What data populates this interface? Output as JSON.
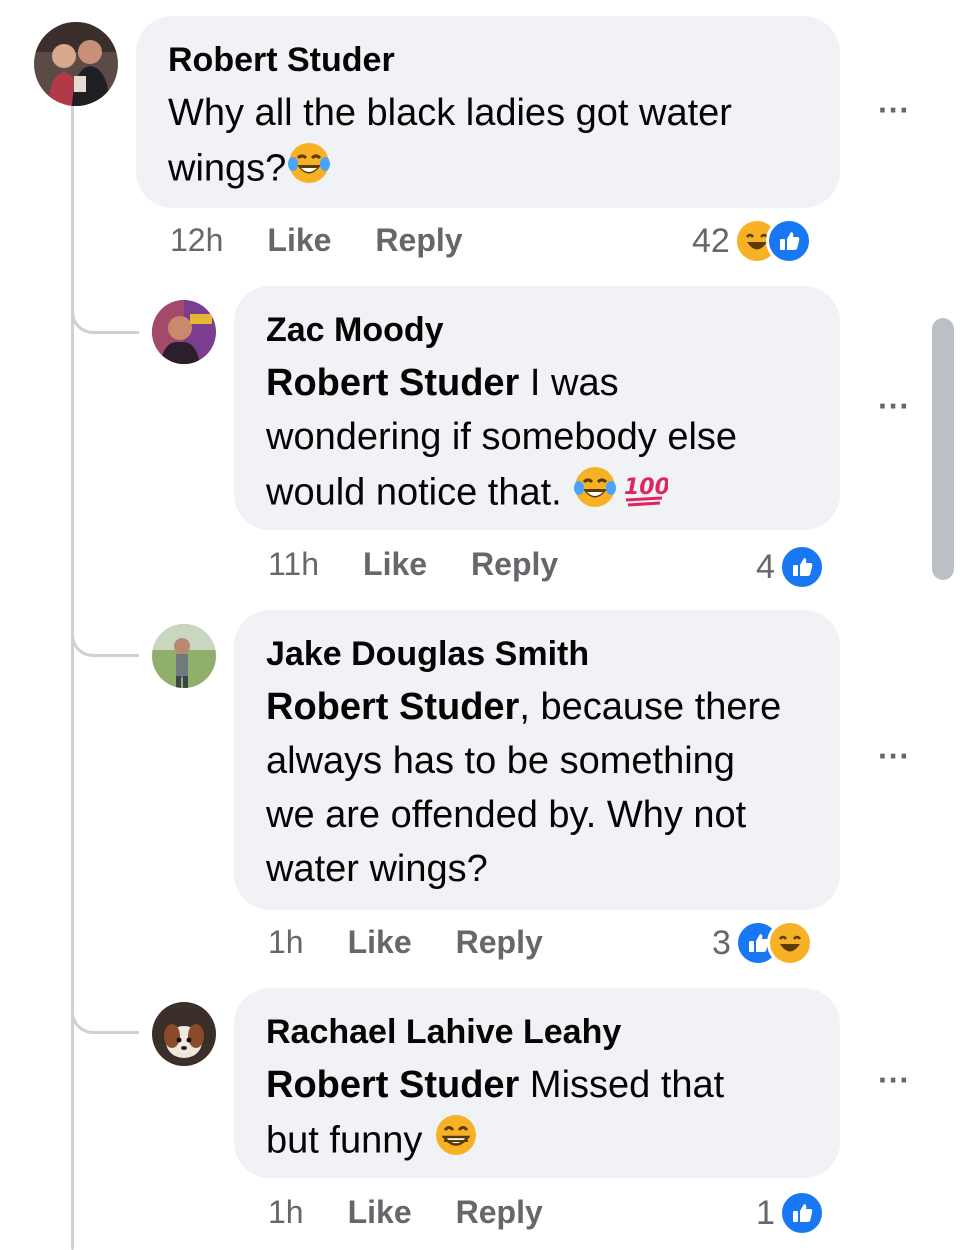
{
  "comments": [
    {
      "author": "Robert Studer",
      "text_lines": [
        "Why all the black ladies got water",
        "wings?"
      ],
      "time": "12h",
      "like_label": "Like",
      "reply_label": "Reply",
      "reaction_count": "42",
      "reactions": [
        "haha",
        "like"
      ]
    },
    {
      "author": "Zac Moody",
      "mention": "Robert Studer",
      "text_lines": [
        " I was",
        "wondering if somebody else",
        "would notice that. "
      ],
      "time": "11h",
      "like_label": "Like",
      "reply_label": "Reply",
      "reaction_count": "4",
      "reactions": [
        "like"
      ]
    },
    {
      "author": "Jake Douglas Smith",
      "mention": "Robert Studer",
      "text_lines": [
        ", because there",
        "always has to be something",
        "we are offended by. Why not",
        "water wings?"
      ],
      "time": "1h",
      "like_label": "Like",
      "reply_label": "Reply",
      "reaction_count": "3",
      "reactions": [
        "like",
        "haha"
      ]
    },
    {
      "author": "Rachael Lahive Leahy",
      "mention": "Robert Studer",
      "text_lines": [
        " Missed that",
        "but funny "
      ],
      "time": "1h",
      "like_label": "Like",
      "reply_label": "Reply",
      "reaction_count": "1",
      "reactions": [
        "like"
      ]
    }
  ],
  "more_label": "···",
  "emoji_hundred": "100",
  "colors": {
    "bubble": "#f0f2f5",
    "meta": "#65676b",
    "like_blue": "#1877f2",
    "haha_yellow": "#f7b125"
  },
  "icons": [
    "laughing-tears-emoji-icon",
    "hundred-points-emoji-icon",
    "grinning-emoji-icon",
    "like-reaction-icon",
    "haha-reaction-icon",
    "more-options-icon"
  ]
}
